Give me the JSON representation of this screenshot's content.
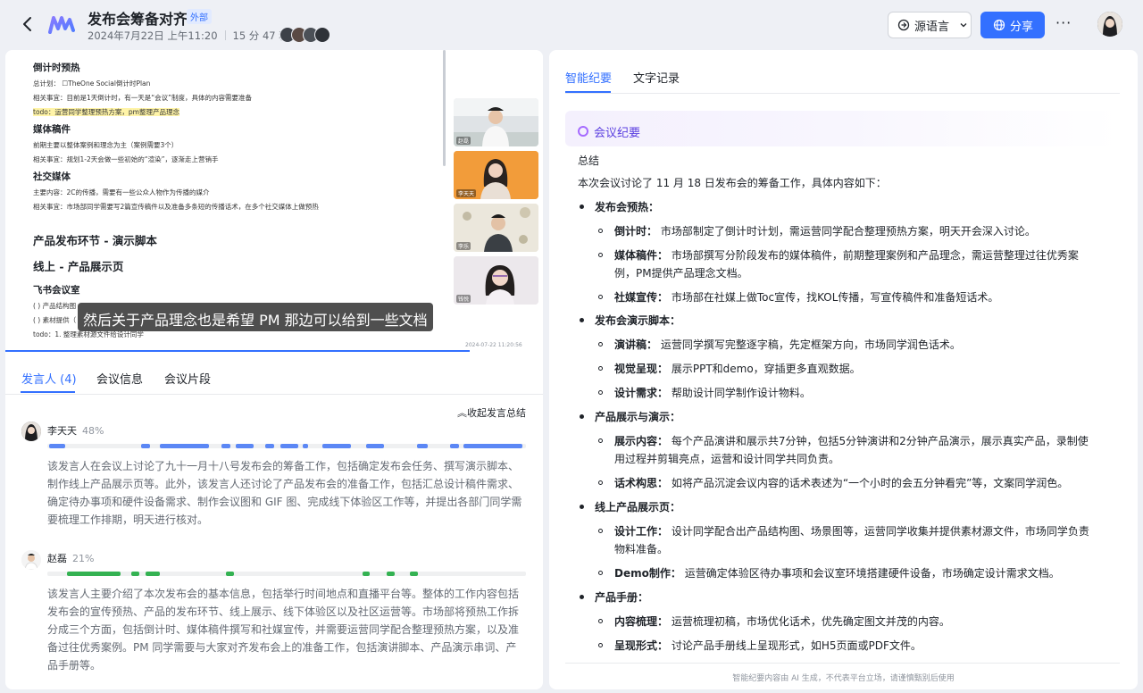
{
  "header": {
    "title": "发布会筹备对齐",
    "tag": "外部",
    "date": "2024年7月22日 上午11:20",
    "duration": "15 分 47 秒",
    "source_language_label": "源语言",
    "share_label": "分享",
    "more_label": "···"
  },
  "video": {
    "doc": {
      "sec1_title": "倒计时预热",
      "sec1_l1": "总计划：  ☐TheOne Social倒计时Plan",
      "sec1_l2": "相关事宜：目前是1天倒计时，有一天是“会议”制度，具体的内容需要准备",
      "sec1_l3": "todo：运营同学整理预热方案，pm整理产品理念",
      "sec2_title": "媒体稿件",
      "sec2_l1": "前期主要以整体案例和理念为主（案例需要3个）",
      "sec2_l2": "相关事宜：规划1-2天会做一些初始的“渲染”，逐渐走上营销手",
      "sec3_title": "社交媒体",
      "sec3_l1": "主要内容：2C的传播，需要有一些公众人物作为传播的媒介",
      "sec3_l2": "相关事宜：市场部同学需要写2篇宣传稿件以及准备多条短的传播话术，在多个社交媒体上做预热",
      "sec4_title": "产品发布环节 - 演示脚本",
      "sec5_title": "线上 - 产品展示页",
      "sec6_title": "飞书会议室",
      "sec6_l1": "( ) 产品结构图",
      "sec6_l2": "( ) 素材提供（",
      "sec6_l3": "todo：1. 整理素材源文件给设计同学"
    },
    "participants": [
      "赵磊",
      "李天天",
      "李乐",
      "钱悦"
    ],
    "caption": "然后关于产品理念也是希望 PM 那边可以给到一些文档",
    "timestamp": "2024-07-22 11:20:56"
  },
  "left_tabs": {
    "speakers": "发言人 (4)",
    "meeting_info": "会议信息",
    "clips": "会议片段"
  },
  "collapse_label": "收起发言总结",
  "speakers": [
    {
      "name": "李天天",
      "percent": "48%",
      "share": 0.48,
      "color": "#5b87f5",
      "summary": "该发言人在会议上讨论了九十一月十八号发布会的筹备工作，包括确定发布会任务、撰写演示脚本、制作线上产品展示页等。此外，该发言人还讨论了产品发布会的准备工作，包括汇总设计稿件需求、确定待办事项和硬件设备需求、制作会议图和 GIF 图、完成线下体验区工作等，并提出各部门同学需要梳理工作排期，明天进行核对。"
    },
    {
      "name": "赵磊",
      "percent": "21%",
      "share": 0.21,
      "color": "#34b252",
      "summary": "该发言人主要介绍了本次发布会的基本信息，包括举行时间地点和直播平台等。整体的工作内容包括发布会的宣传预热、产品的发布环节、线上展示、线下体验区以及社区运营等。市场部将预热工作拆分成三个方面，包括倒计时、媒体稿件撰写和社媒宣传，并需要运营同学配合整理预热方案，以及准备过往优秀案例。PM 同学需要与大家对齐发布会上的准备工作，包括演讲脚本、产品演示串词、产品手册等。"
    }
  ],
  "right_tabs": {
    "minutes": "智能纪要",
    "transcript": "文字记录"
  },
  "minutes": {
    "card_title": "会议纪要",
    "summary_heading": "总结",
    "intro": "本次会议讨论了 11 月 18 日发布会的筹备工作，具体内容如下：",
    "sections": [
      {
        "title": "发布会预热：",
        "items": [
          {
            "label": "倒计时：",
            "text": "市场部制定了倒计时计划，需运营同学配合整理预热方案，明天开会深入讨论。"
          },
          {
            "label": "媒体稿件：",
            "text": "市场部撰写分阶段发布的媒体稿件，前期整理案例和产品理念，需运营整理过往优秀案例，PM提供产品理念文档。"
          },
          {
            "label": "社媒宣传：",
            "text": "市场部在社媒上做Toc宣传，找KOL传播，写宣传稿件和准备短话术。"
          }
        ]
      },
      {
        "title": "发布会演示脚本：",
        "items": [
          {
            "label": "演讲稿：",
            "text": "运营同学撰写完整逐字稿，先定框架方向，市场同学润色话术。"
          },
          {
            "label": "视觉呈现：",
            "text": "展示PPT和demo，穿插更多直观数据。"
          },
          {
            "label": "设计需求：",
            "text": "帮助设计同学制作设计物料。"
          }
        ]
      },
      {
        "title": "产品展示与演示：",
        "items": [
          {
            "label": "展示内容：",
            "text": "每个产品演讲和展示共7分钟，包括5分钟演讲和2分钟产品演示，展示真实产品，录制使用过程并剪辑亮点，运营和设计同学共同负责。"
          },
          {
            "label": "话术构思：",
            "text": "如将产品沉淀会议内容的话术表述为“一个小时的会五分钟看完”等，文案同学润色。"
          }
        ]
      },
      {
        "title": "线上产品展示页：",
        "items": [
          {
            "label": "设计工作：",
            "text": "设计同学配合出产品结构图、场景图等，运营同学收集并提供素材源文件，市场同学负责物料准备。"
          },
          {
            "label": "Demo制作：",
            "text": "运营确定体验区待办事项和会议室环境搭建硬件设备，市场确定设计需求文档。"
          }
        ]
      },
      {
        "title": "产品手册：",
        "items": [
          {
            "label": "内容梳理：",
            "text": "运营梳理初稿，市场优化话术，优先确定图文并茂的内容。"
          },
          {
            "label": "呈现形式：",
            "text": "讨论产品手册线上呈现形式，如H5页面或PDF文件。"
          }
        ]
      }
    ],
    "footer": "智能纪要内容由 AI 生成，不代表平台立场，请谨慎甄别后使用"
  },
  "colors": {
    "accent": "#3370ff",
    "speaker1": "#5b87f5",
    "speaker2": "#34b252"
  }
}
